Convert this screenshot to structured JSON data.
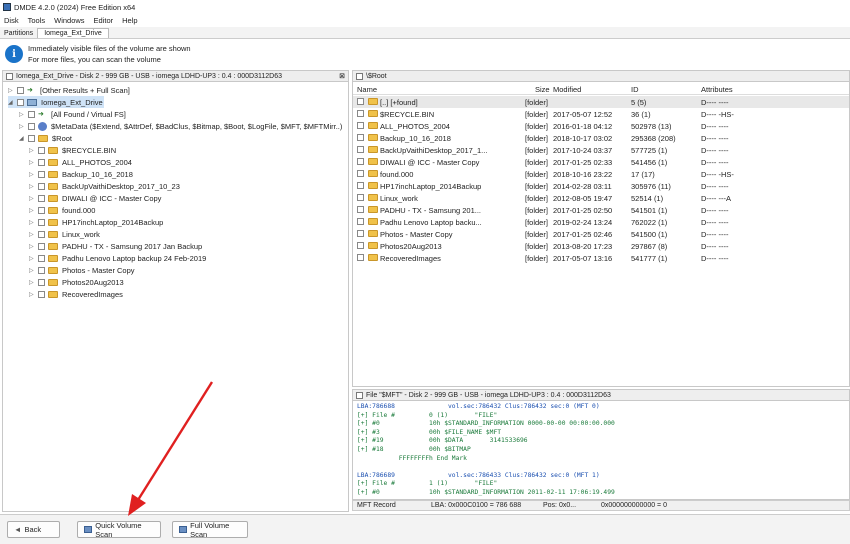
{
  "window": {
    "title": "DMDE 4.2.0 (2024) Free Edition x64"
  },
  "menu": [
    "Disk",
    "Tools",
    "Windows",
    "Editor",
    "Help"
  ],
  "tabs": {
    "label": "Partitions",
    "active": "Iomega_Ext_Drive"
  },
  "info": {
    "line1": "Immediately visible files of the volume are shown",
    "line2": "For more files, you can scan the volume"
  },
  "left_panel": {
    "header": "Iomega_Ext_Drive - Disk 2 - 999 GB - USB - iomega LDHD-UP3 : 0.4 : 000D3112D63",
    "tree": [
      {
        "label": "[Other Results + Full Scan]",
        "indent": 0,
        "tri": "▷",
        "icon": "arrow"
      },
      {
        "label": "Iomega_Ext_Drive",
        "indent": 0,
        "tri": "◢",
        "icon": "drive",
        "selected": true
      },
      {
        "label": "[All Found / Virtual FS]",
        "indent": 1,
        "tri": "▷",
        "icon": "arrow"
      },
      {
        "label": "$MetaData ($Extend, $AttrDef, $BadClus, $Bitmap, $Boot, $LogFile, $MFT, $MFTMirr..)",
        "indent": 1,
        "tri": "▷",
        "icon": "meta"
      },
      {
        "label": "$Root",
        "indent": 1,
        "tri": "◢",
        "icon": "folder"
      },
      {
        "label": "$RECYCLE.BIN",
        "indent": 2,
        "tri": "▷",
        "icon": "folder"
      },
      {
        "label": "ALL_PHOTOS_2004",
        "indent": 2,
        "tri": "▷",
        "icon": "folder"
      },
      {
        "label": "Backup_10_16_2018",
        "indent": 2,
        "tri": "▷",
        "icon": "folder"
      },
      {
        "label": "BackUpVaithiDesktop_2017_10_23",
        "indent": 2,
        "tri": "▷",
        "icon": "folder"
      },
      {
        "label": "DIWALI @ ICC - Master Copy",
        "indent": 2,
        "tri": "▷",
        "icon": "folder"
      },
      {
        "label": "found.000",
        "indent": 2,
        "tri": "▷",
        "icon": "folder"
      },
      {
        "label": "HP17inchLaptop_2014Backup",
        "indent": 2,
        "tri": "▷",
        "icon": "folder"
      },
      {
        "label": "Linux_work",
        "indent": 2,
        "tri": "▷",
        "icon": "folder"
      },
      {
        "label": "PADHU - TX - Samsung 2017 Jan Backup",
        "indent": 2,
        "tri": "▷",
        "icon": "folder"
      },
      {
        "label": "Padhu Lenovo Laptop backup 24 Feb-2019",
        "indent": 2,
        "tri": "▷",
        "icon": "folder"
      },
      {
        "label": "Photos - Master Copy",
        "indent": 2,
        "tri": "▷",
        "icon": "folder"
      },
      {
        "label": "Photos20Aug2013",
        "indent": 2,
        "tri": "▷",
        "icon": "folder"
      },
      {
        "label": "RecoveredImages",
        "indent": 2,
        "tri": "▷",
        "icon": "folder"
      }
    ]
  },
  "right_panel": {
    "header": "\\$Root",
    "columns": {
      "name": "Name",
      "size": "Size",
      "modified": "Modified",
      "id": "ID",
      "attributes": "Attributes"
    },
    "rows": [
      {
        "name": "[..] [+found]",
        "size": "[folder]",
        "modified": "",
        "id": "5 (5)",
        "attr": "D---- ----"
      },
      {
        "name": "$RECYCLE.BIN",
        "size": "[folder]",
        "modified": "2017-05-07 12:52",
        "id": "36 (1)",
        "attr": "D---- -HS-"
      },
      {
        "name": "ALL_PHOTOS_2004",
        "size": "[folder]",
        "modified": "2016-01-18 04:12",
        "id": "502978 (13)",
        "attr": "D---- ----"
      },
      {
        "name": "Backup_10_16_2018",
        "size": "[folder]",
        "modified": "2018-10-17 03:02",
        "id": "295368 (208)",
        "attr": "D---- ----"
      },
      {
        "name": "BackUpVaithiDesktop_2017_1...",
        "size": "[folder]",
        "modified": "2017-10-24 03:37",
        "id": "577725 (1)",
        "attr": "D---- ----"
      },
      {
        "name": "DIWALI @ ICC - Master Copy",
        "size": "[folder]",
        "modified": "2017-01-25 02:33",
        "id": "541456 (1)",
        "attr": "D---- ----"
      },
      {
        "name": "found.000",
        "size": "[folder]",
        "modified": "2018-10-16 23:22",
        "id": "17 (17)",
        "attr": "D---- -HS-"
      },
      {
        "name": "HP17inchLaptop_2014Backup",
        "size": "[folder]",
        "modified": "2014-02-28 03:11",
        "id": "305976 (11)",
        "attr": "D---- ----"
      },
      {
        "name": "Linux_work",
        "size": "[folder]",
        "modified": "2012-08-05 19:47",
        "id": "52514 (1)",
        "attr": "D---- ---A"
      },
      {
        "name": "PADHU - TX - Samsung 201...",
        "size": "[folder]",
        "modified": "2017-01-25 02:50",
        "id": "541501 (1)",
        "attr": "D---- ----"
      },
      {
        "name": "Padhu Lenovo Laptop backu...",
        "size": "[folder]",
        "modified": "2019-02-24 13:24",
        "id": "762022 (1)",
        "attr": "D---- ----"
      },
      {
        "name": "Photos - Master Copy",
        "size": "[folder]",
        "modified": "2017-01-25 02:46",
        "id": "541500 (1)",
        "attr": "D---- ----"
      },
      {
        "name": "Photos20Aug2013",
        "size": "[folder]",
        "modified": "2013-08-20 17:23",
        "id": "297867 (8)",
        "attr": "D---- ----"
      },
      {
        "name": "RecoveredImages",
        "size": "[folder]",
        "modified": "2017-05-07 13:16",
        "id": "541777 (1)",
        "attr": "D---- ----"
      }
    ]
  },
  "mft_panel": {
    "header": "File \"$MFT\" - Disk 2 - 999 GB - USB - iomega LDHD-UP3 : 0.4 : 000D3112D63",
    "lines": [
      {
        "text": "LBA:786688              vol.sec:786432 Clus:786432 sec:0 (MFT 0)",
        "blue": true
      },
      {
        "text": "[+] File #         0 (1)       \"FILE\"",
        "blue": false
      },
      {
        "text": "[+] #0             10h $STANDARD_INFORMATION 0000-00-00 00:00:00.000",
        "blue": false
      },
      {
        "text": "[+] #3             00h $FILE_NAME $MFT",
        "blue": false
      },
      {
        "text": "[+] #19            00h $DATA       3141533696",
        "blue": false
      },
      {
        "text": "[+] #18            00h $BITMAP",
        "blue": false
      },
      {
        "text": "           FFFFFFFFh End Mark",
        "blue": false
      },
      {
        "text": "",
        "blue": false
      },
      {
        "text": "LBA:786689              vol.sec:786433 Clus:786432 sec:0 (MFT 1)",
        "blue": true
      },
      {
        "text": "[+] File #         1 (1)       \"FILE\"",
        "blue": false
      },
      {
        "text": "[+] #0             10h $STANDARD_INFORMATION 2011-02-11 17:06:19.499",
        "blue": false
      }
    ]
  },
  "status": {
    "label": "MFT Record",
    "lba": "LBA: 0x000C0100 = 786 688",
    "pos": "Pos: 0x0...",
    "hex": "0x000000000000 = 0"
  },
  "buttons": {
    "back": "Back",
    "quick_scan": "Quick Volume Scan",
    "full_scan": "Full Volume Scan"
  },
  "colors": {
    "accent": "#1a73c9",
    "folder": "#f0c24a",
    "annotation_arrow": "#e02020"
  }
}
